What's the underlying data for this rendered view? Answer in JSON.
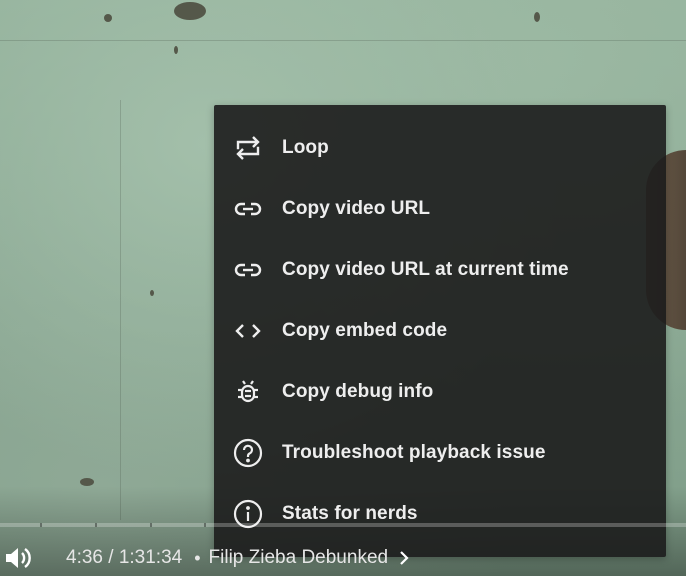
{
  "menu": {
    "items": [
      {
        "label": "Loop",
        "icon": "loop-icon"
      },
      {
        "label": "Copy video URL",
        "icon": "link-icon"
      },
      {
        "label": "Copy video URL at current time",
        "icon": "link-time-icon"
      },
      {
        "label": "Copy embed code",
        "icon": "embed-code-icon"
      },
      {
        "label": "Copy debug info",
        "icon": "bug-icon"
      },
      {
        "label": "Troubleshoot playback issue",
        "icon": "help-circle-icon"
      },
      {
        "label": "Stats for nerds",
        "icon": "info-circle-icon"
      }
    ]
  },
  "player": {
    "time": "4:36 / 1:31:34",
    "separator": "•",
    "chapter_title": "Filip Zieba Debunked",
    "volume_icon": "volume-icon",
    "chevron_icon": "chevron-right-icon"
  },
  "colors": {
    "menu_bg": "#1c1c1c",
    "menu_text": "#eeeeee",
    "control_text": "#e6e6e6"
  }
}
